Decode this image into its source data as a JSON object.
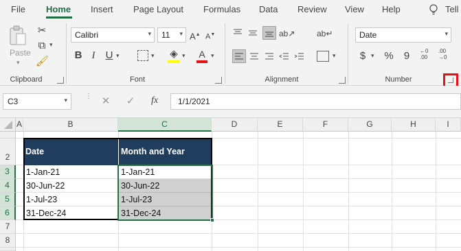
{
  "menu": {
    "tabs": [
      "File",
      "Home",
      "Insert",
      "Page Layout",
      "Formulas",
      "Data",
      "Review",
      "View",
      "Help",
      "Tell"
    ]
  },
  "ribbon": {
    "clipboard": {
      "paste_label": "Paste",
      "group_label": "Clipboard"
    },
    "font": {
      "font_name": "Calibri",
      "font_size": "11",
      "group_label": "Font"
    },
    "alignment": {
      "group_label": "Alignment"
    },
    "number": {
      "format": "Date",
      "group_label": "Number",
      "currency_symbol": "$",
      "percent_symbol": "%",
      "comma_symbol": "9"
    }
  },
  "formula_bar": {
    "name_box": "C3",
    "fx_label": "fx",
    "value": "1/1/2021"
  },
  "grid": {
    "columns": [
      "A",
      "B",
      "C",
      "D",
      "E",
      "F",
      "G",
      "H",
      "I"
    ],
    "selected_column": "C",
    "rows": [
      "2",
      "3",
      "4",
      "5",
      "6",
      "7",
      "8"
    ],
    "table": {
      "headers": [
        "Date",
        "Month and Year"
      ],
      "date_col": [
        "1-Jan-21",
        "30-Jun-22",
        "1-Jul-23",
        "31-Dec-24"
      ],
      "month_year_col": [
        "1-Jan-21",
        "30-Jun-22",
        "1-Jul-23",
        "31-Dec-24"
      ]
    }
  },
  "colors": {
    "accent": "#217346",
    "header_fill": "#203d5e",
    "highlight_box": "#e81010"
  }
}
